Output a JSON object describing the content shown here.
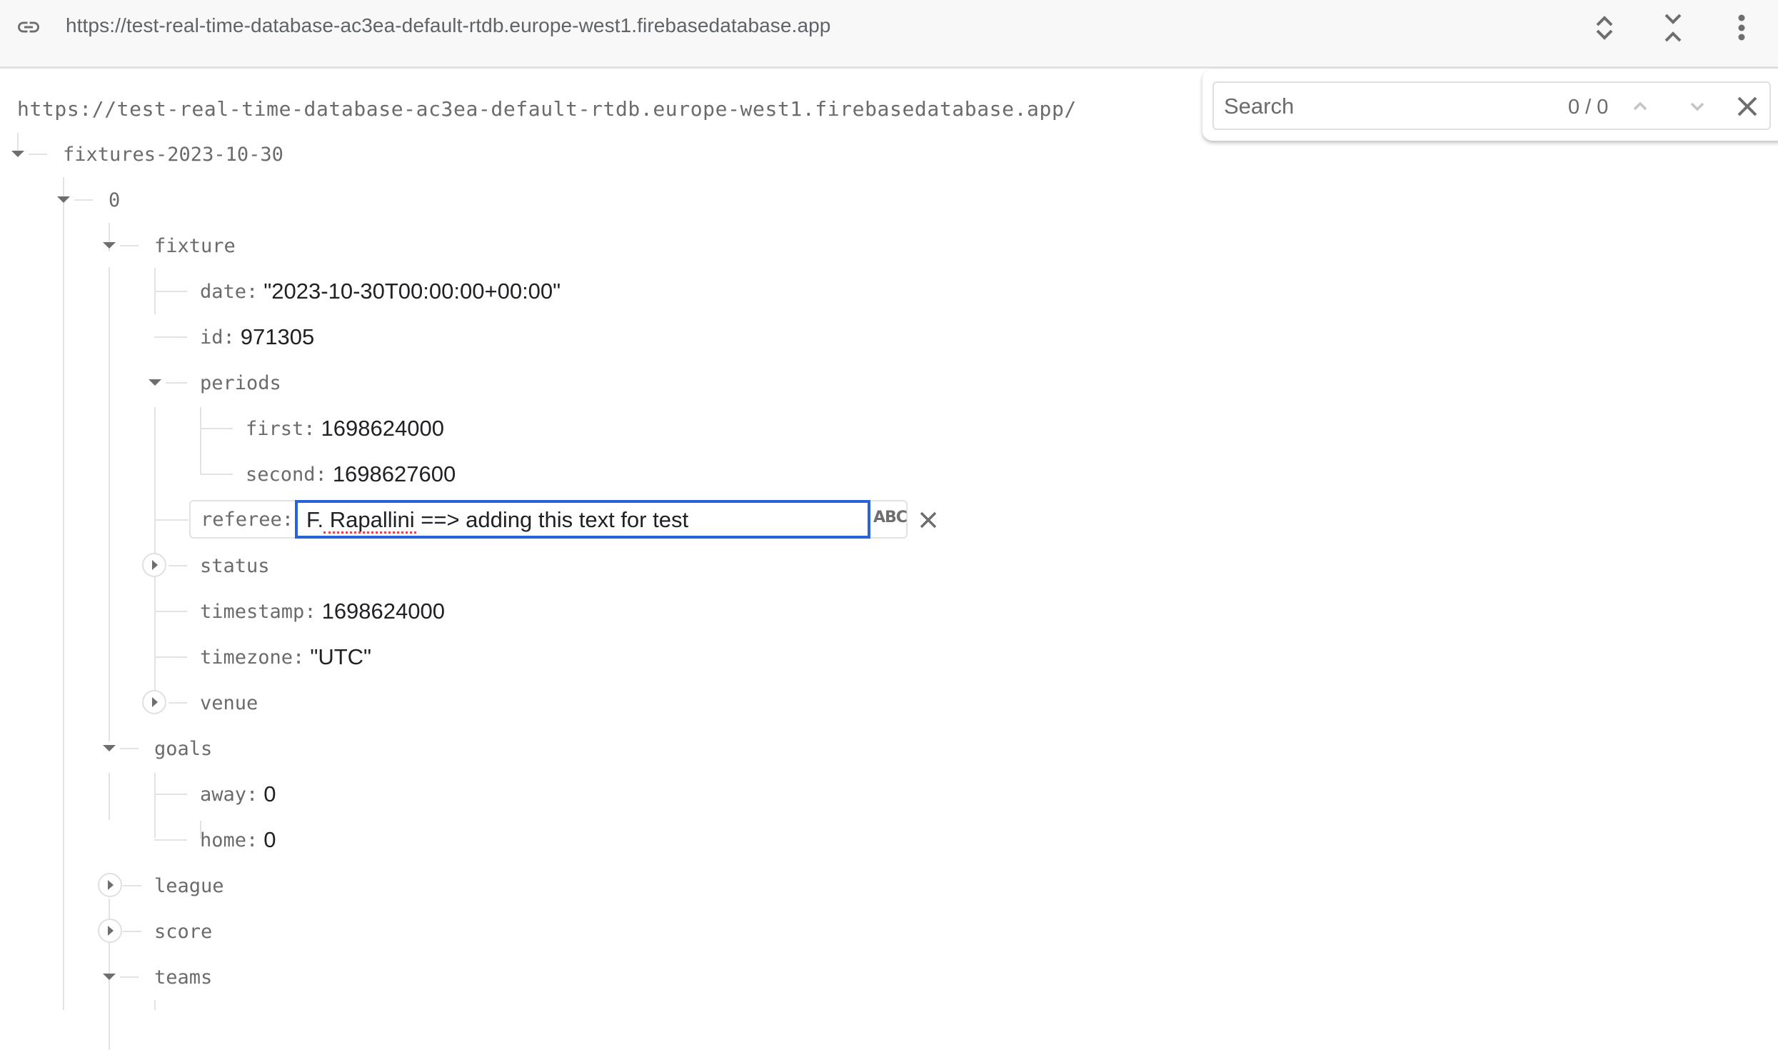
{
  "topbar": {
    "url": "https://test-real-time-database-ac3ea-default-rtdb.europe-west1.firebasedatabase.app",
    "icons": [
      "link-icon",
      "expand-all-icon",
      "collapse-all-icon",
      "more-vert-icon"
    ]
  },
  "search": {
    "placeholder": "Search",
    "value": "",
    "count": "0 / 0",
    "icons": [
      "chevron-up-icon",
      "chevron-down-icon",
      "close-icon"
    ]
  },
  "tree": {
    "root_url": "https://test-real-time-database-ac3ea-default-rtdb.europe-west1.firebasedatabase.app/",
    "node_fixtures": "fixtures-2023-10-30",
    "node_0": "0",
    "node_fixture": "fixture",
    "date": {
      "key": "date",
      "value": "\"2023-10-30T00:00:00+00:00\""
    },
    "id": {
      "key": "id",
      "value": "971305"
    },
    "node_periods": "periods",
    "first": {
      "key": "first",
      "value": "1698624000"
    },
    "second": {
      "key": "second",
      "value": "1698627600"
    },
    "referee": {
      "key": "referee",
      "value": "F. Rapallini ==> adding this text for test",
      "editor_type_label": "ABC"
    },
    "node_status": "status",
    "timestamp": {
      "key": "timestamp",
      "value": "1698624000"
    },
    "timezone": {
      "key": "timezone",
      "value": "\"UTC\""
    },
    "node_venue": "venue",
    "node_goals": "goals",
    "away": {
      "key": "away",
      "value": "0"
    },
    "home": {
      "key": "home",
      "value": "0"
    },
    "node_league": "league",
    "node_score": "score",
    "node_teams": "teams"
  },
  "colors": {
    "accent": "#2a62d9",
    "key_text": "#6b6b6b",
    "value_text": "#202124",
    "tree_line": "#e3e3e3"
  }
}
